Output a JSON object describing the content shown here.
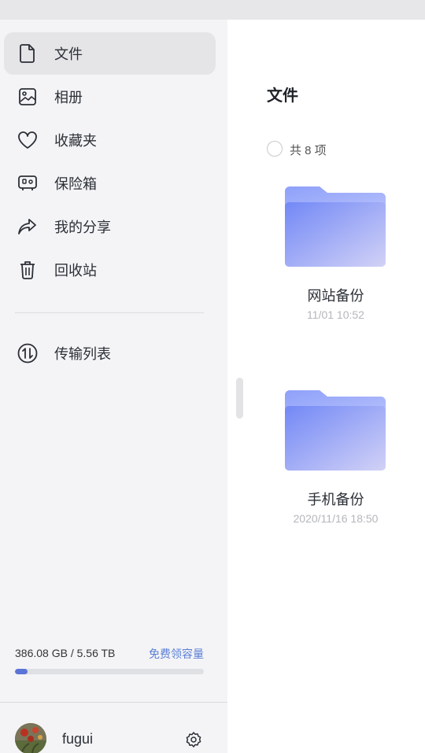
{
  "sidebar": {
    "items": [
      {
        "label": "文件",
        "icon": "file-icon"
      },
      {
        "label": "相册",
        "icon": "photo-icon"
      },
      {
        "label": "收藏夹",
        "icon": "heart-icon"
      },
      {
        "label": "保险箱",
        "icon": "safe-icon"
      },
      {
        "label": "我的分享",
        "icon": "share-icon"
      },
      {
        "label": "回收站",
        "icon": "trash-icon"
      }
    ],
    "transfer": {
      "label": "传输列表",
      "icon": "transfer-icon"
    },
    "storage": {
      "used_text": "386.08 GB / 5.56 TB",
      "link": "免费领容量",
      "used_fraction": 0.068
    },
    "user": {
      "name": "fugui"
    }
  },
  "main": {
    "title": "文件",
    "count": "共 8 项",
    "files": [
      {
        "name": "网站备份",
        "date": "11/01 10:52"
      },
      {
        "name": "手机备份",
        "date": "2020/11/16 18:50"
      }
    ]
  },
  "colors": {
    "accent": "#5b74d6",
    "link": "#5b7fd6",
    "folder_light": "#c9c9f5",
    "folder_dark": "#7b8ff7"
  }
}
